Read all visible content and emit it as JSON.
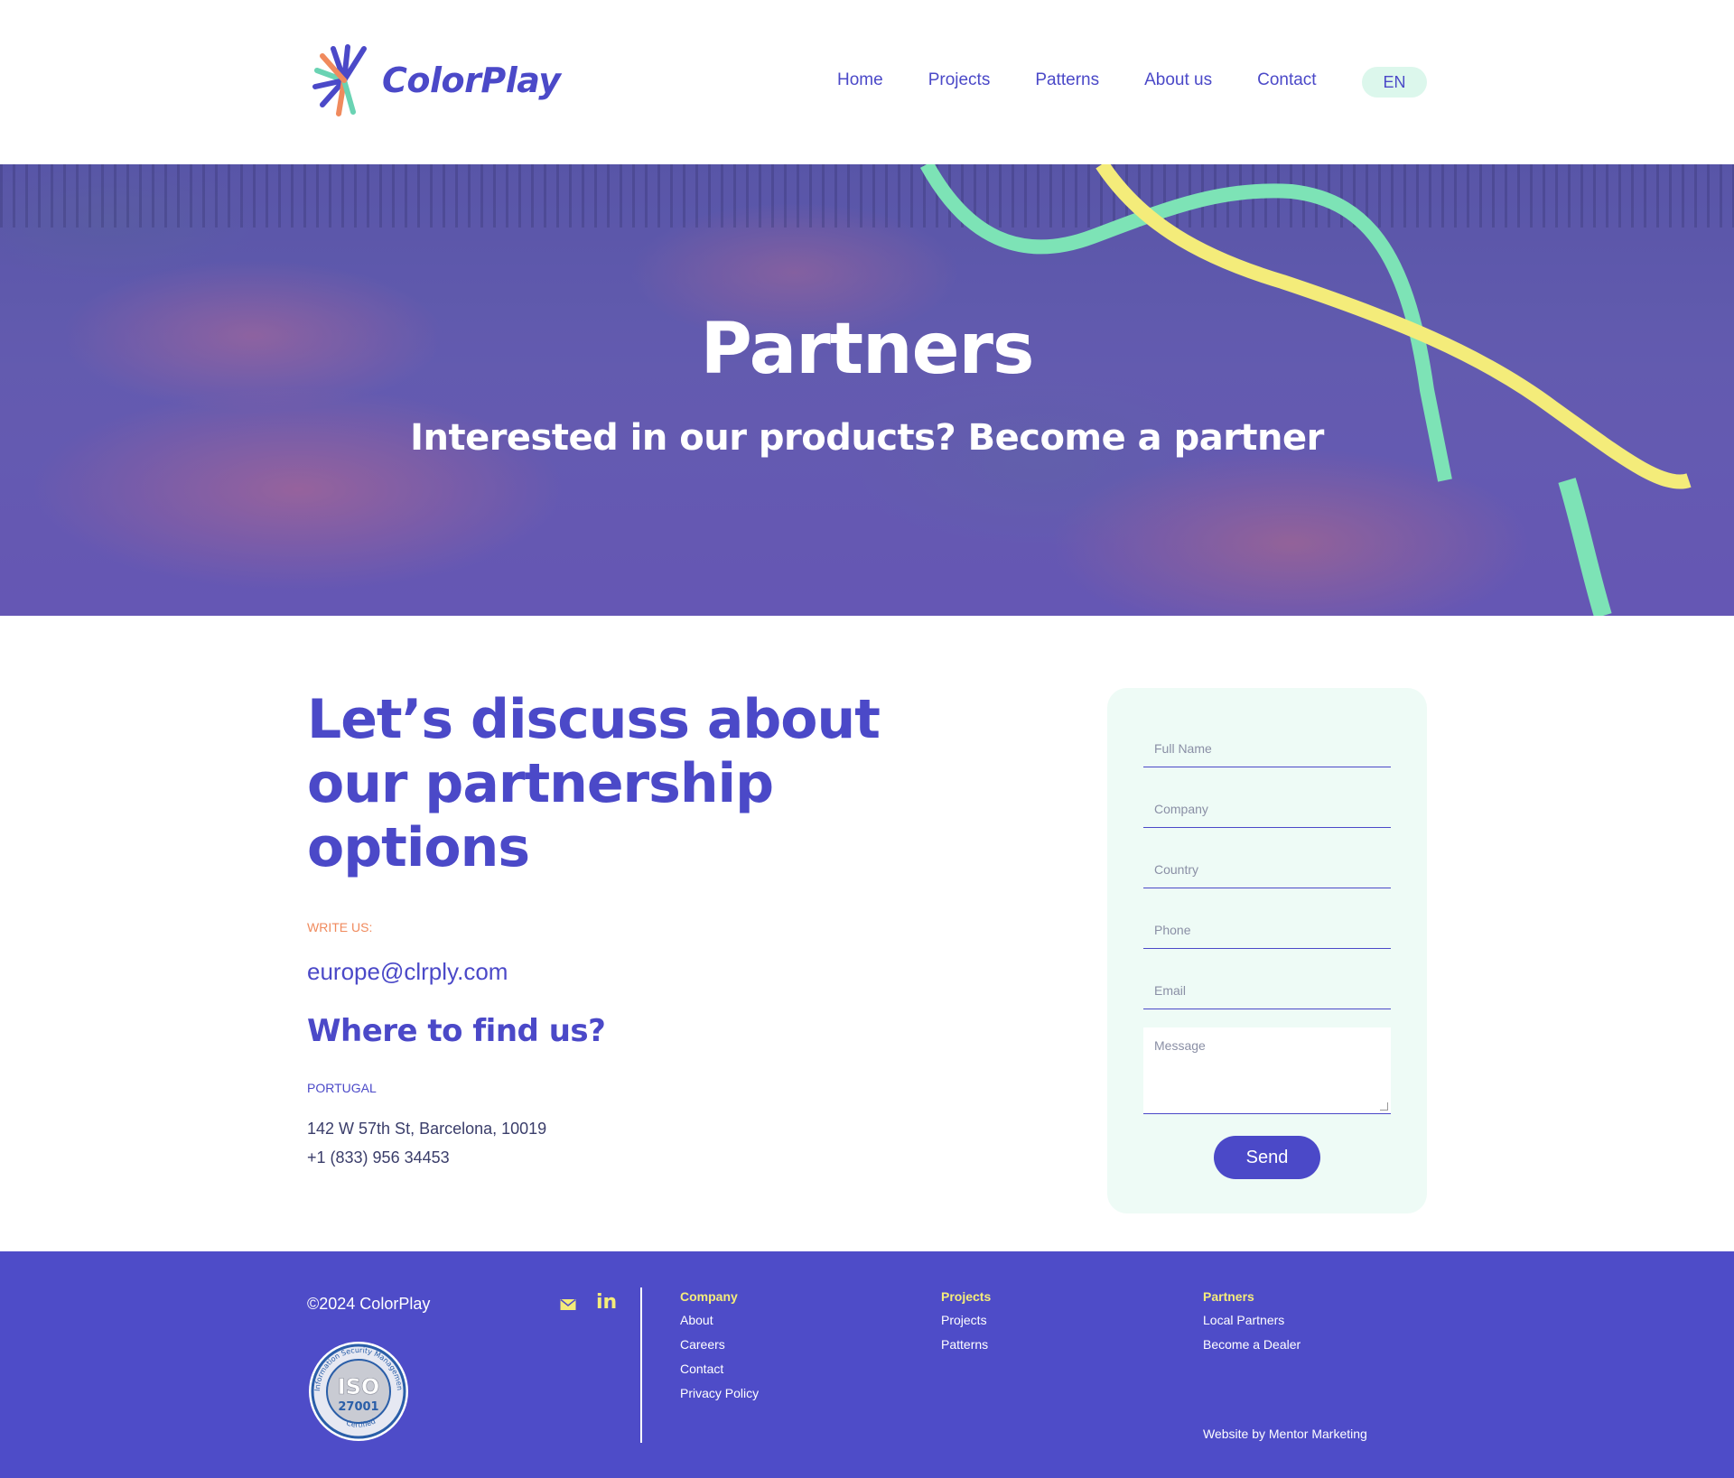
{
  "header": {
    "logo_text": "ColorPlay",
    "nav": [
      "Home",
      "Projects",
      "Patterns",
      "About us",
      "Contact"
    ],
    "lang": "EN"
  },
  "hero": {
    "title": "Partners",
    "subtitle": "Interested in our products? Become a partner"
  },
  "contact": {
    "headline": "Let’s discuss about our partnership options",
    "write_label": "WRITE US:",
    "email": "europe@clrply.com",
    "find_title": "Where to find us?",
    "country": "PORTUGAL",
    "address": "142 W 57th St, Barcelona, 10019",
    "phone": "+1 (833) 956 34453"
  },
  "form": {
    "full_name_placeholder": "Full Name",
    "company_placeholder": "Company",
    "country_placeholder": "Country",
    "phone_placeholder": "Phone",
    "email_placeholder": "Email",
    "message_placeholder": "Message",
    "send_label": "Send"
  },
  "footer": {
    "copyright": "©2024 ColorPlay",
    "iso": {
      "top": "Information Security Management",
      "mark": "ISO",
      "number": "27001",
      "bottom": "Certified"
    },
    "company": {
      "title": "Company",
      "links": [
        "About",
        "Careers",
        "Contact",
        "Privacy Policy"
      ]
    },
    "projects": {
      "title": "Projects",
      "links": [
        "Projects",
        "Patterns"
      ]
    },
    "partners": {
      "title": "Partners",
      "links": [
        "Local Partners",
        "Become a Dealer"
      ]
    },
    "credit": "Website by  Mentor Marketing"
  },
  "colors": {
    "brand": "#4b49c8",
    "mint": "#7de3b6",
    "yellow": "#f4ec7a",
    "orange": "#f08a5d"
  }
}
